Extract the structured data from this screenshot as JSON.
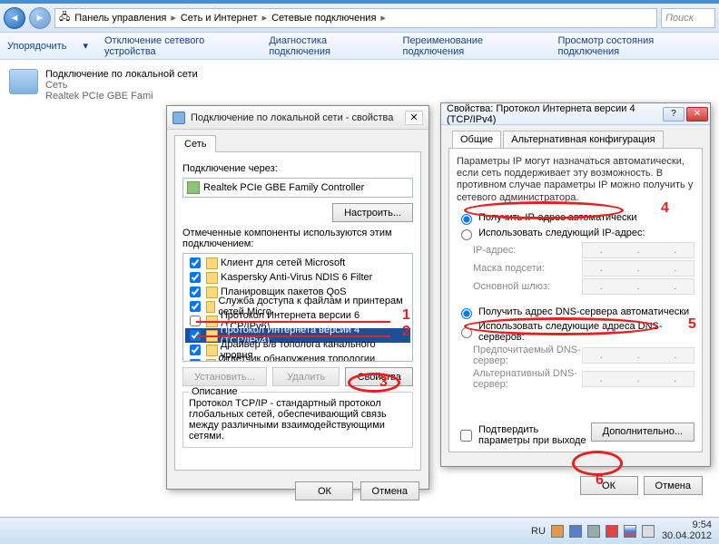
{
  "nav": {
    "crumbs": [
      "Панель управления",
      "Сеть и Интернет",
      "Сетевые подключения"
    ],
    "search": "Поиск"
  },
  "toolbar": {
    "organize": "Упорядочить",
    "disable": "Отключение сетевого устройства",
    "diagnose": "Диагностика подключения",
    "rename": "Переименование подключения",
    "status": "Просмотр состояния подключения"
  },
  "conn": {
    "name": "Подключение по локальной сети",
    "sub": "Сеть",
    "adapter": "Realtek PCIe GBE Fami"
  },
  "dlg1": {
    "title": "Подключение по локальной сети - свойства",
    "tab": "Сеть",
    "via": "Подключение через:",
    "adapter": "Realtek PCIe GBE Family Controller",
    "configure": "Настроить...",
    "mark": "Отмеченные компоненты используются этим подключением:",
    "items": [
      {
        "chk": true,
        "label": "Клиент для сетей Microsoft"
      },
      {
        "chk": true,
        "label": "Kaspersky Anti-Virus NDIS 6 Filter"
      },
      {
        "chk": true,
        "label": "Планировщик пакетов QoS"
      },
      {
        "chk": true,
        "label": "Служба доступа к файлам и принтерам сетей Micro..."
      },
      {
        "chk": false,
        "label": "Протокол Интернета версии 6 (TCP/IPv6)"
      },
      {
        "chk": true,
        "label": "Протокол Интернета версии 4 (TCP/IPv4)",
        "sel": true
      },
      {
        "chk": true,
        "label": "Драйвер в/в тополога канального уровня"
      },
      {
        "chk": true,
        "label": "Ответчик обнаружения топологии канального уровня"
      }
    ],
    "install": "Установить...",
    "remove": "Удалить",
    "props": "Свойства",
    "desc_t": "Описание",
    "desc": "Протокол TCP/IP - стандартный протокол глобальных сетей, обеспечивающий связь между различными взаимодействующими сетями.",
    "ok": "ОК",
    "cancel": "Отмена"
  },
  "dlg2": {
    "title": "Свойства: Протокол Интернета версии 4 (TCP/IPv4)",
    "tab_general": "Общие",
    "tab_alt": "Альтернативная конфигурация",
    "info": "Параметры IP могут назначаться автоматически, если сеть поддерживает эту возможность. В противном случае параметры IP можно получить у сетевого администратора.",
    "r_auto_ip": "Получить IP-адрес автоматически",
    "r_man_ip": "Использовать следующий IP-адрес:",
    "f_ip": "IP-адрес:",
    "f_mask": "Маска подсети:",
    "f_gw": "Основной шлюз:",
    "r_auto_dns": "Получить адрес DNS-сервера автоматически",
    "r_man_dns": "Использовать следующие адреса DNS-серверов:",
    "f_dns1": "Предпочитаемый DNS-сервер:",
    "f_dns2": "Альтернативный DNS-сервер:",
    "validate": "Подтвердить параметры при выходе",
    "advanced": "Дополнительно...",
    "ok": "ОК",
    "cancel": "Отмена"
  },
  "ann": {
    "n1": "1",
    "n2": "2",
    "n3": "3",
    "n4": "4",
    "n5": "5",
    "n6": "6"
  },
  "taskbar": {
    "lang": "RU",
    "time": "9:54",
    "date": "30.04.2012"
  }
}
